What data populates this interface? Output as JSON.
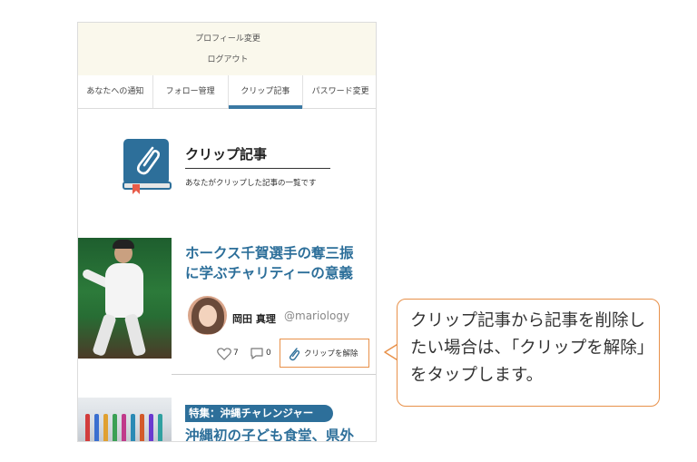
{
  "menu": {
    "profile_change": "プロフィール変更",
    "logout": "ログアウト"
  },
  "tabs": [
    {
      "label": "あなたへの通知",
      "active": false
    },
    {
      "label": "フォロー管理",
      "active": false
    },
    {
      "label": "クリップ記事",
      "active": true
    },
    {
      "label": "パスワード変更",
      "active": false
    }
  ],
  "section": {
    "title": "クリップ記事",
    "description": "あなたがクリップした記事の一覧です",
    "icon": "clip-book-icon"
  },
  "articles": [
    {
      "title": "ホークス千賀選手の奪三振に学ぶチャリティーの意義",
      "author_name": "岡田 真理",
      "author_handle": "@mariology",
      "likes": "7",
      "comments": "0",
      "unclip_label": "クリップを解除"
    },
    {
      "tag": "特集：沖縄チャレンジャー",
      "title": "沖縄初の子ども食堂、県外"
    }
  ],
  "callout": {
    "text": "クリップ記事から記事を削除したい場合は、「クリップを解除」をタップします。"
  },
  "colors": {
    "accent_blue": "#2d6f9a",
    "callout_orange": "#e8914a",
    "menu_bg": "#faf8ec"
  }
}
